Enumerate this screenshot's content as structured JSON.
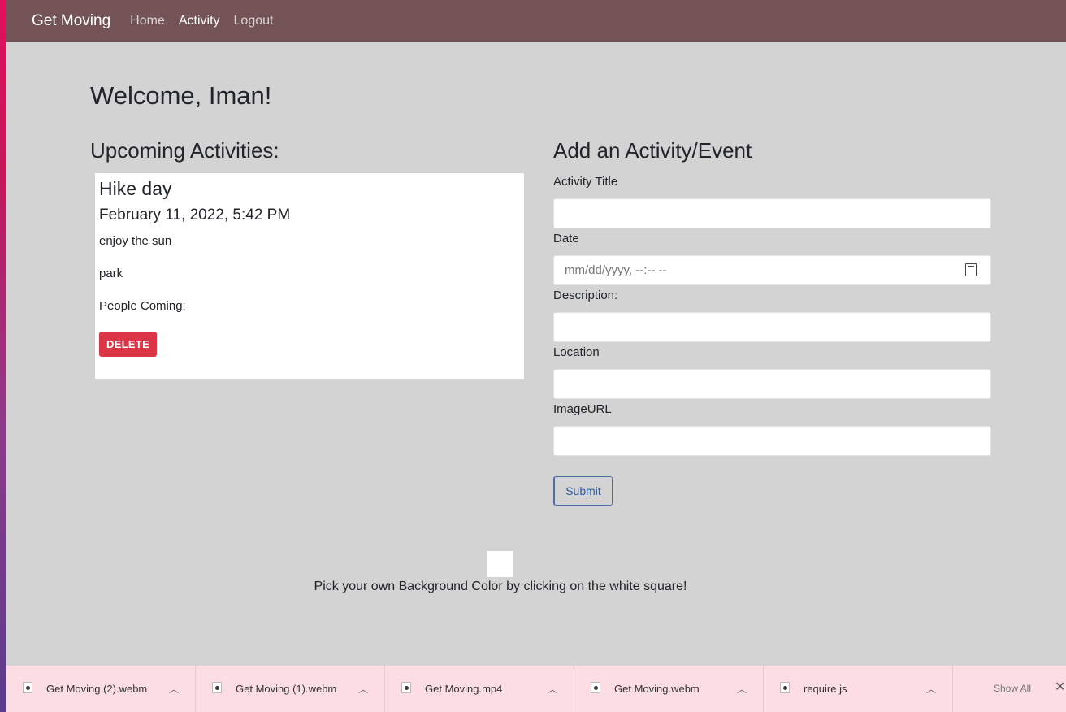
{
  "navbar": {
    "brand": "Get Moving",
    "links": [
      {
        "label": "Home"
      },
      {
        "label": "Activity"
      },
      {
        "label": "Logout"
      }
    ]
  },
  "main": {
    "welcome": "Welcome, Iman!",
    "upcoming_title": "Upcoming Activities:",
    "activity": {
      "title": "Hike day",
      "date": "February 11, 2022, 5:42 PM",
      "description": "enjoy the sun",
      "location": "park",
      "people_coming": "People Coming:",
      "delete_label": "DELETE"
    },
    "form": {
      "title": "Add an Activity/Event",
      "activity_title_label": "Activity Title",
      "activity_title_value": "",
      "date_label": "Date",
      "date_placeholder": "mm/dd/yyyy, --:-- --",
      "description_label": "Description:",
      "description_value": "",
      "location_label": "Location",
      "location_value": "",
      "image_url_label": "ImageURL",
      "image_url_value": "",
      "submit_label": "Submit"
    },
    "color_hint": "Pick your own Background Color by clicking on the white square!"
  },
  "downloads": {
    "items": [
      {
        "name": "Get Moving (2).webm"
      },
      {
        "name": "Get Moving (1).webm"
      },
      {
        "name": "Get Moving.mp4"
      },
      {
        "name": "Get Moving.webm"
      },
      {
        "name": "require.js"
      }
    ],
    "show_all_label": "Show All"
  },
  "colors": {
    "navbar": "#735355",
    "page_bg": "#d3d3d3",
    "delete": "#dc3545",
    "download_bar": "#fbdde3"
  }
}
